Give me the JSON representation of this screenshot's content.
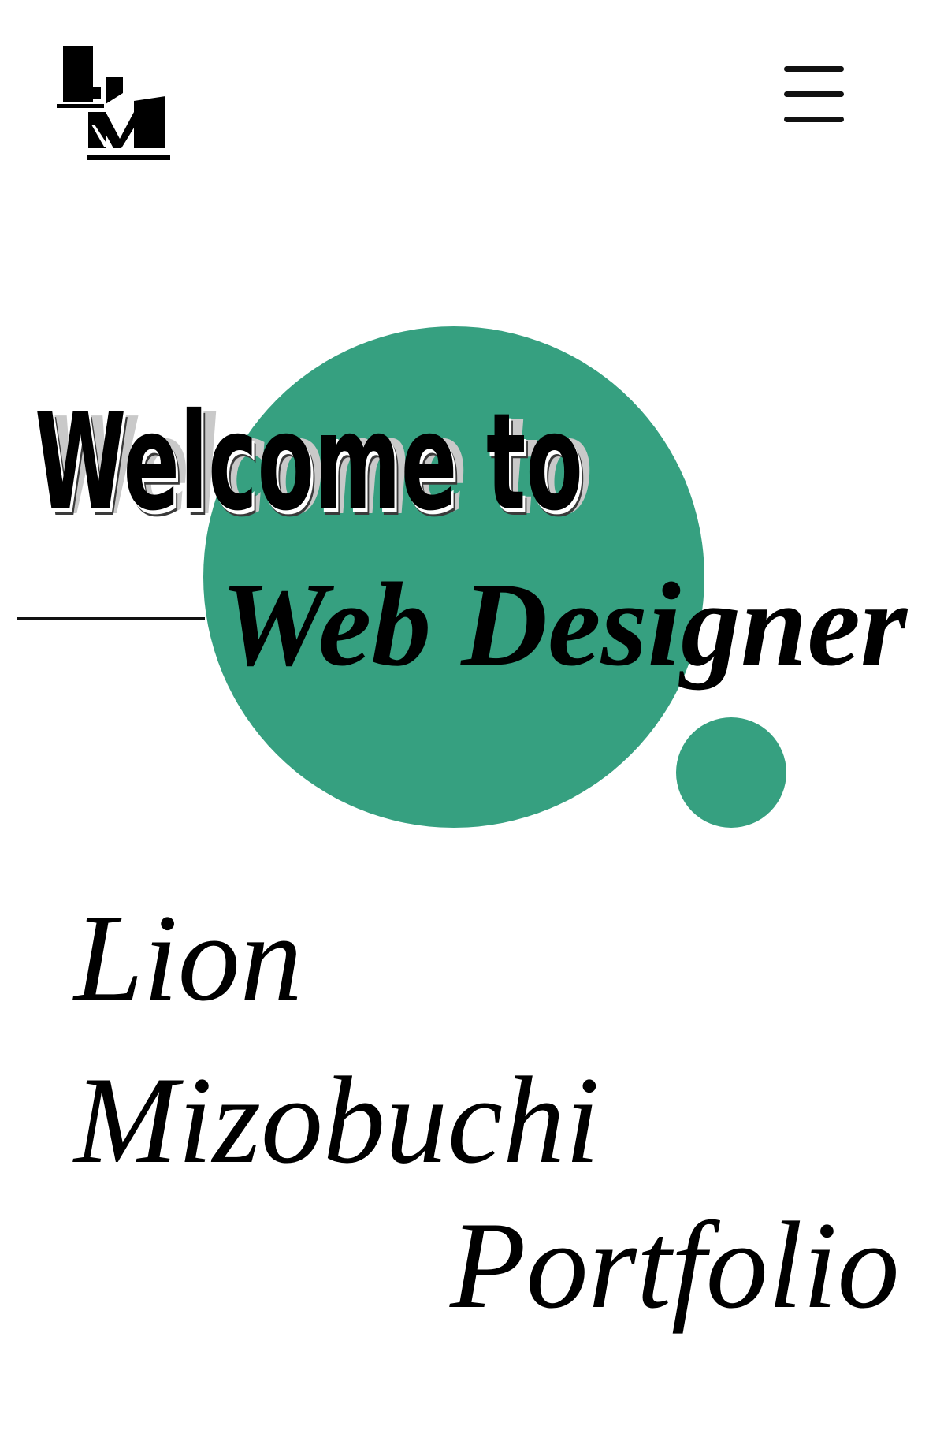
{
  "header": {
    "logo_icon": "lm-monogram-logo-icon",
    "menu_icon": "hamburger-menu-icon"
  },
  "hero": {
    "welcome": "Welcome to",
    "role": "Web Designer",
    "name_first": "Lion",
    "name_last": "Mizobuchi",
    "portfolio": "Portfolio",
    "accent_color": "#36a080"
  }
}
